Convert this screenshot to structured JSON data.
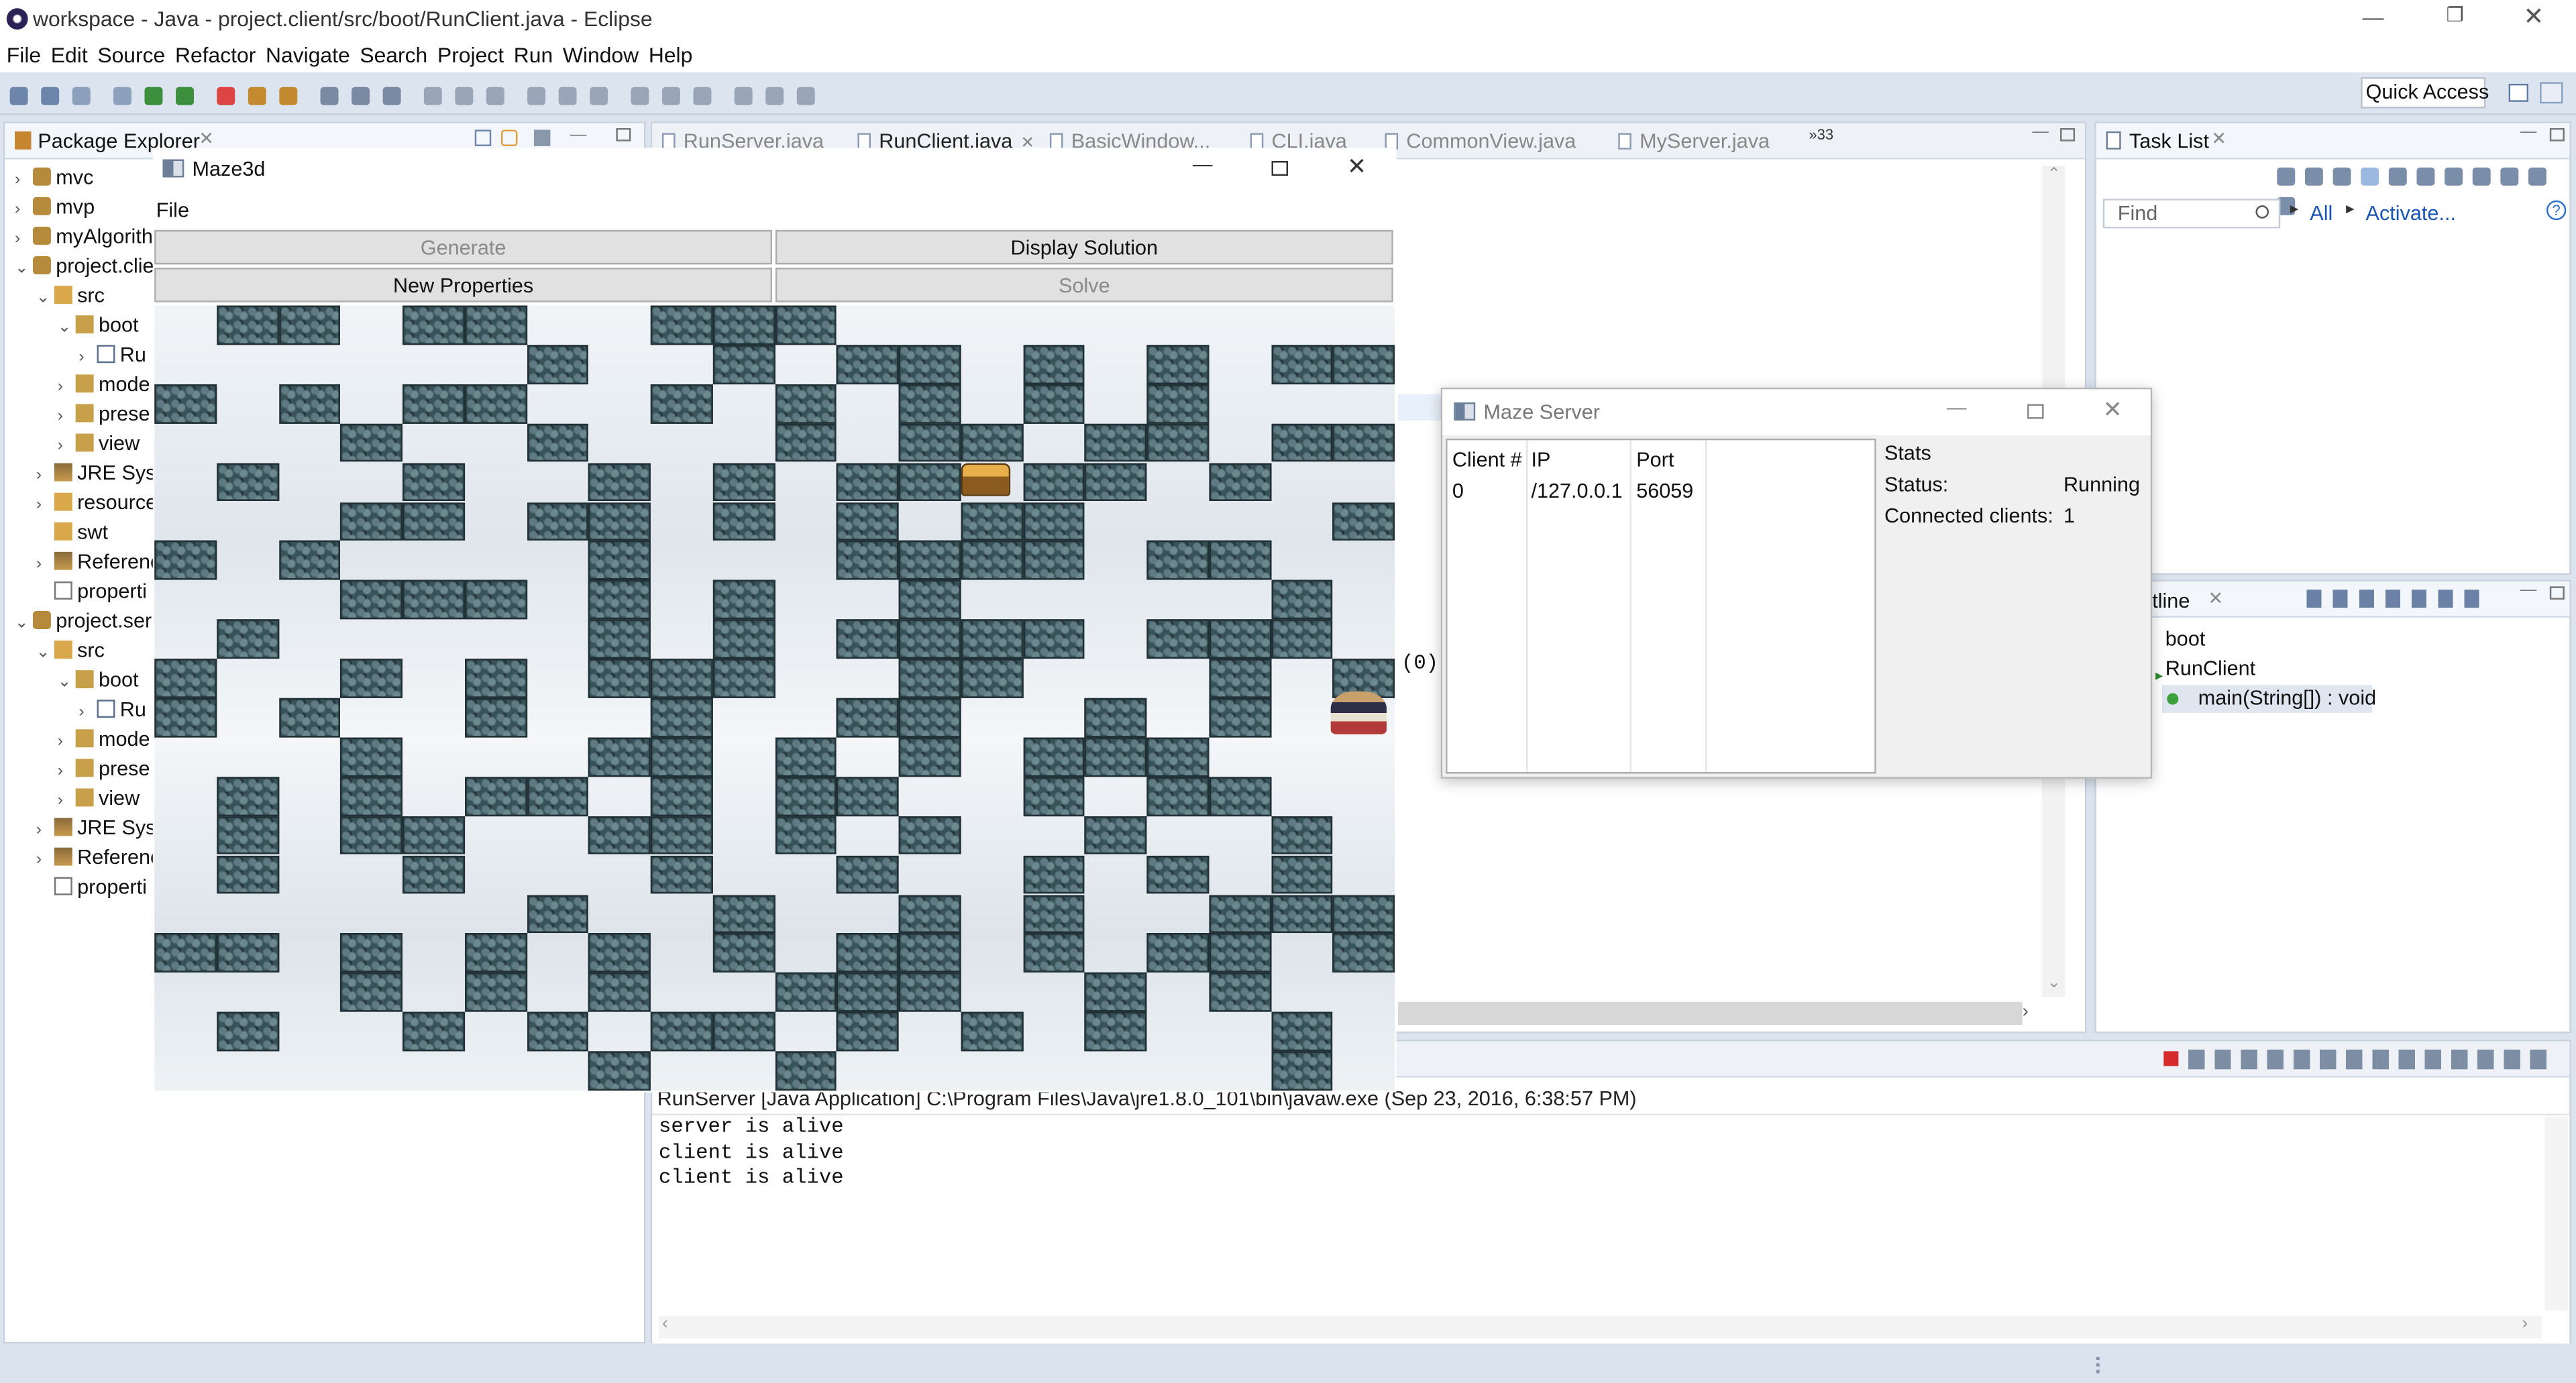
{
  "app": {
    "window_title": "workspace - Java - project.client/src/boot/RunClient.java - Eclipse",
    "menus": [
      "File",
      "Edit",
      "Source",
      "Refactor",
      "Navigate",
      "Search",
      "Project",
      "Run",
      "Window",
      "Help"
    ],
    "quick_access": "Quick Access"
  },
  "package_explorer": {
    "title": "Package Explorer",
    "items": [
      {
        "label": "mvc",
        "depth": 0,
        "arrow": ">"
      },
      {
        "label": "mvp",
        "depth": 0,
        "arrow": ">"
      },
      {
        "label": "myAlgorith",
        "depth": 0,
        "arrow": ">"
      },
      {
        "label": "project.clie",
        "depth": 0,
        "arrow": "v"
      },
      {
        "label": "src",
        "depth": 1,
        "arrow": "v"
      },
      {
        "label": "boot",
        "depth": 2,
        "arrow": "v"
      },
      {
        "label": "Ru",
        "depth": 3,
        "arrow": ">"
      },
      {
        "label": "mode",
        "depth": 2,
        "arrow": ">"
      },
      {
        "label": "prese",
        "depth": 2,
        "arrow": ">"
      },
      {
        "label": "view",
        "depth": 2,
        "arrow": ">"
      },
      {
        "label": "JRE Syst",
        "depth": 1,
        "arrow": ">"
      },
      {
        "label": "resource",
        "depth": 1,
        "arrow": ">"
      },
      {
        "label": "swt",
        "depth": 1,
        "arrow": ""
      },
      {
        "label": "Referenc",
        "depth": 1,
        "arrow": ">"
      },
      {
        "label": "properti",
        "depth": 1,
        "arrow": ""
      },
      {
        "label": "project.ser",
        "depth": 0,
        "arrow": "v"
      },
      {
        "label": "src",
        "depth": 1,
        "arrow": "v"
      },
      {
        "label": "boot",
        "depth": 2,
        "arrow": "v"
      },
      {
        "label": "Ru",
        "depth": 3,
        "arrow": ">"
      },
      {
        "label": "mode",
        "depth": 2,
        "arrow": ">"
      },
      {
        "label": "prese",
        "depth": 2,
        "arrow": ">"
      },
      {
        "label": "view",
        "depth": 2,
        "arrow": ">"
      },
      {
        "label": "JRE Syst",
        "depth": 1,
        "arrow": ">"
      },
      {
        "label": "Referenc",
        "depth": 1,
        "arrow": ">"
      },
      {
        "label": "properti",
        "depth": 1,
        "arrow": ""
      }
    ]
  },
  "editor": {
    "tabs": [
      "RunServer.java",
      "RunClient.java",
      "BasicWindow...",
      "CLI.java",
      "CommonView.java",
      "MyServer.java"
    ],
    "overflow": "»33",
    "code_fragment": "(0),"
  },
  "maze_window": {
    "title": "Maze3d",
    "menu_file": "File",
    "buttons": {
      "generate": "Generate",
      "display_solution": "Display Solution",
      "new_properties": "New Properties",
      "solve": "Solve"
    }
  },
  "server_window": {
    "title": "Maze Server",
    "table": {
      "headers": [
        "Client #",
        "IP",
        "Port"
      ],
      "rows": [
        [
          "0",
          "/127.0.0.1",
          "56059"
        ]
      ]
    },
    "stats": {
      "title": "Stats",
      "status_label": "Status:",
      "status_value": "Running",
      "clients_label": "Connected clients:",
      "clients_value": "1"
    }
  },
  "task_list": {
    "title": "Task List",
    "find_placeholder": "Find",
    "all": "All",
    "activate": "Activate..."
  },
  "outline": {
    "title": "tline",
    "items": [
      "boot",
      "RunClient",
      "main(String[]) : void"
    ]
  },
  "console": {
    "header": "RunServer [Java Application] C:\\Program Files\\Java\\jre1.8.0_101\\bin\\javaw.exe (Sep 23, 2016, 6:38:57 PM)",
    "lines": [
      "server is alive",
      "client is alive",
      "client is alive"
    ]
  },
  "colors": {
    "accent": "#dae3ee",
    "wall": "#385259",
    "selection": "#d7e3f5"
  }
}
